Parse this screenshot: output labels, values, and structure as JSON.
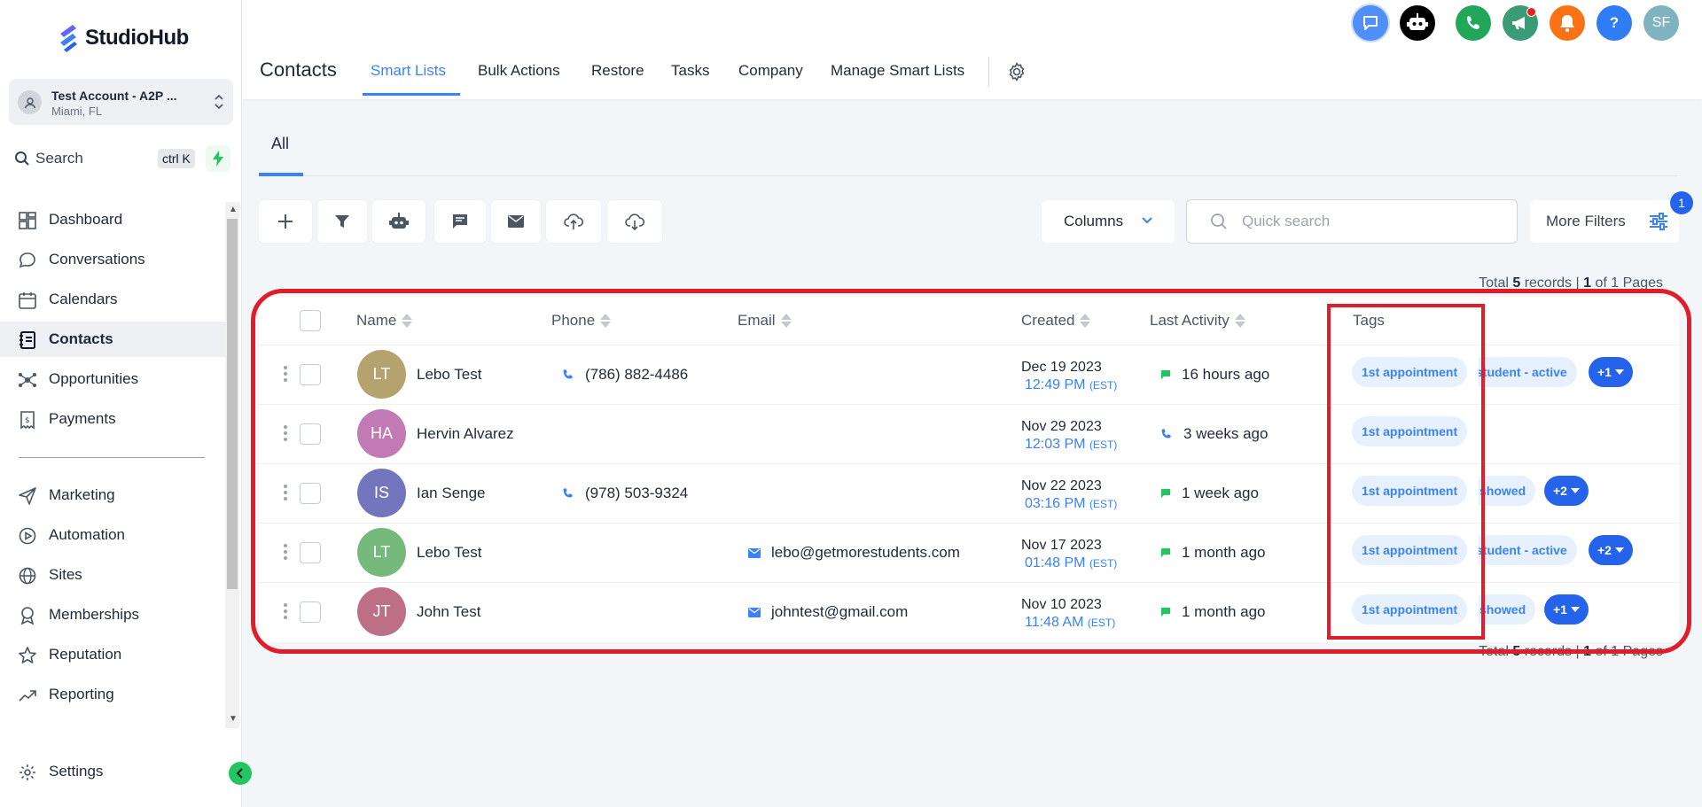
{
  "brand": {
    "name": "StudioHub"
  },
  "account": {
    "name": "Test Account - A2P ...",
    "location": "Miami, FL"
  },
  "search": {
    "label": "Search",
    "shortcut": "ctrl K"
  },
  "sidebar": {
    "items": [
      {
        "label": "Dashboard",
        "icon": "dashboard-icon"
      },
      {
        "label": "Conversations",
        "icon": "chat-bubble-icon"
      },
      {
        "label": "Calendars",
        "icon": "calendar-icon"
      },
      {
        "label": "Contacts",
        "icon": "contacts-book-icon",
        "active": true
      },
      {
        "label": "Opportunities",
        "icon": "opportunities-icon"
      },
      {
        "label": "Payments",
        "icon": "receipt-icon"
      },
      {
        "label": "Marketing",
        "icon": "send-icon"
      },
      {
        "label": "Automation",
        "icon": "play-circle-icon"
      },
      {
        "label": "Sites",
        "icon": "globe-icon"
      },
      {
        "label": "Memberships",
        "icon": "award-icon"
      },
      {
        "label": "Reputation",
        "icon": "star-icon"
      },
      {
        "label": "Reporting",
        "icon": "trending-up-icon"
      }
    ],
    "settings": "Settings"
  },
  "header": {
    "title": "Contacts",
    "tabs": [
      "Smart Lists",
      "Bulk Actions",
      "Restore",
      "Tasks",
      "Company",
      "Manage Smart Lists"
    ],
    "active_tab": "Smart Lists",
    "user_initials": "SF"
  },
  "subtabs": {
    "all": "All"
  },
  "toolbar": {
    "columns_label": "Columns",
    "quick_search_placeholder": "Quick search",
    "more_filters_label": "More Filters",
    "filter_count": "1"
  },
  "records": {
    "total": "5",
    "page": "1",
    "pages": "1",
    "total_prefix": "Total",
    "records_word": "records |",
    "of_word": "of",
    "pages_word": "Pages"
  },
  "table": {
    "columns": [
      "Name",
      "Phone",
      "Email",
      "Created",
      "Last Activity",
      "Tags"
    ],
    "rows": [
      {
        "initials": "LT",
        "avatar_color": "#b5a36f",
        "name": "Lebo Test",
        "phone": "(786) 882-4486",
        "email": "",
        "created_date": "Dec 19 2023",
        "created_time": "12:49 PM",
        "tz": "(EST)",
        "activity_type": "message",
        "last_activity": "16 hours ago",
        "tags": [
          "1st appointment",
          "student - active"
        ],
        "more_tags": "+1"
      },
      {
        "initials": "HA",
        "avatar_color": "#c27ab4",
        "name": "Hervin Alvarez",
        "phone": "",
        "email": "",
        "created_date": "Nov 29 2023",
        "created_time": "12:03 PM",
        "tz": "(EST)",
        "activity_type": "phone",
        "last_activity": "3 weeks ago",
        "tags": [
          "1st appointment"
        ],
        "more_tags": ""
      },
      {
        "initials": "IS",
        "avatar_color": "#7476bd",
        "name": "Ian Senge",
        "phone": "(978) 503-9324",
        "email": "",
        "created_date": "Nov 22 2023",
        "created_time": "03:16 PM",
        "tz": "(EST)",
        "activity_type": "message",
        "last_activity": "1 week ago",
        "tags": [
          "1st appointment",
          "showed"
        ],
        "more_tags": "+2"
      },
      {
        "initials": "LT",
        "avatar_color": "#76b97c",
        "name": "Lebo Test",
        "phone": "",
        "email": "lebo@getmorestudents.com",
        "created_date": "Nov 17 2023",
        "created_time": "01:48 PM",
        "tz": "(EST)",
        "activity_type": "message",
        "last_activity": "1 month ago",
        "tags": [
          "1st appointment",
          "student - active"
        ],
        "more_tags": "+2"
      },
      {
        "initials": "JT",
        "avatar_color": "#bd6f86",
        "name": "John Test",
        "phone": "",
        "email": "johntest@gmail.com",
        "created_date": "Nov 10 2023",
        "created_time": "11:48 AM",
        "tz": "(EST)",
        "activity_type": "message",
        "last_activity": "1 month ago",
        "tags": [
          "1st appointment",
          "showed"
        ],
        "more_tags": "+1"
      }
    ]
  },
  "colors": {
    "accent": "#3b82f6",
    "highlight": "#e11d2b",
    "green": "#22c55e"
  }
}
